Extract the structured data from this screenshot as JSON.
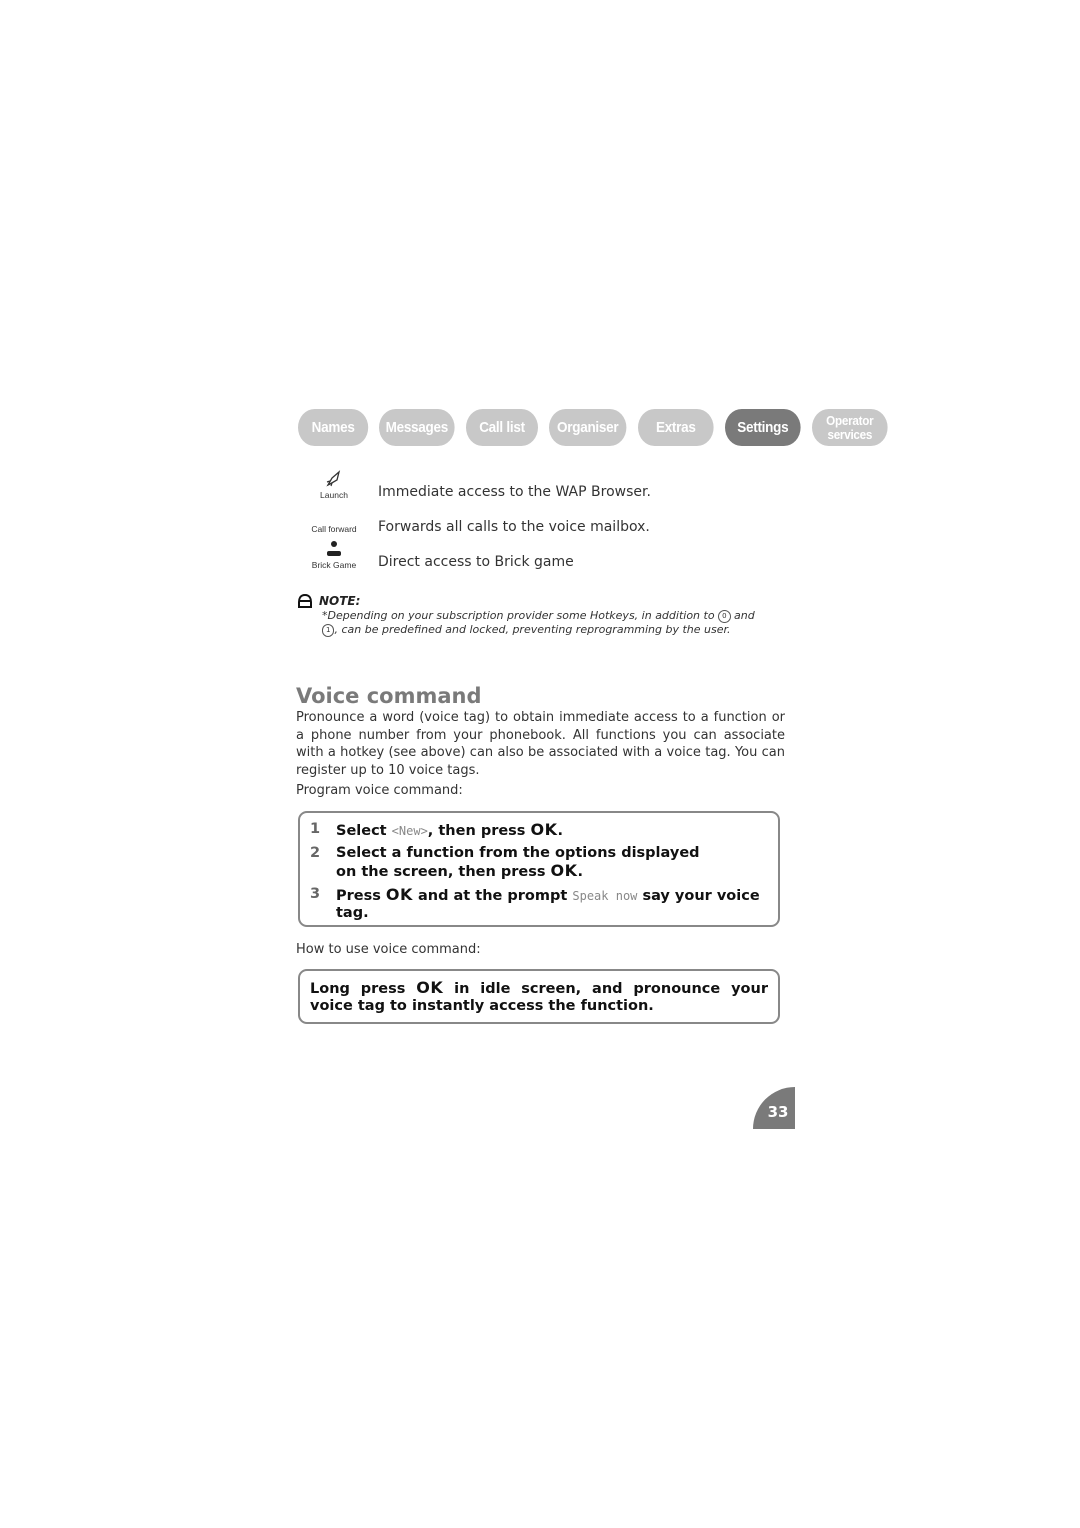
{
  "tabs": [
    {
      "label": "Names",
      "active": false
    },
    {
      "label": "Messages",
      "active": false
    },
    {
      "label": "Call list",
      "active": false
    },
    {
      "label": "Organiser",
      "active": false
    },
    {
      "label": "Extras",
      "active": false
    },
    {
      "label": "Settings",
      "active": true
    },
    {
      "label_line1": "Operator",
      "label_line2": "services",
      "active": false
    }
  ],
  "hotkeys": [
    {
      "icon": "rocket-icon",
      "label": "Launch",
      "description": "Immediate access to the WAP Browser."
    },
    {
      "icon": "",
      "label": "Call forward",
      "description": "Forwards all calls to the voice mailbox."
    },
    {
      "icon": "brick-game-icon",
      "label": "Brick Game",
      "description": "Direct access to Brick game"
    }
  ],
  "note": {
    "heading": "NOTE:",
    "text_part1": "*Depending on your subscription provider some Hotkeys, in addition to",
    "key1": "0",
    "text_part2": "and",
    "key2": "1",
    "text_part3": ", can be predefined and locked, preventing reprogramming by the user."
  },
  "section": {
    "title": "Voice command",
    "paragraph": "Pronounce a word (voice tag) to obtain immediate access to a function or a phone number from your phonebook. All functions you can associate with a hotkey (see above) can also be associated with a voice tag. You can register up to 10 voice tags.",
    "program_label": "Program voice command:",
    "steps": [
      {
        "num": "1",
        "pre": "Select ",
        "code": "<New>",
        "post": ", then press ",
        "ok": "OK",
        "end": "."
      },
      {
        "num": "2",
        "pre": "Select a function from the options displayed on the screen, then press ",
        "ok": "OK",
        "end": "."
      },
      {
        "num": "3",
        "pre": "Press ",
        "ok": "OK",
        "mid": " and at the prompt ",
        "code": "Speak now",
        "end": " say your voice tag."
      }
    ],
    "use_label": "How to use voice command:",
    "use_box": {
      "pre": "Long press ",
      "ok": "OK",
      "post": " in idle screen, and pronounce your voice tag to instantly access the function."
    }
  },
  "page_number": "33"
}
